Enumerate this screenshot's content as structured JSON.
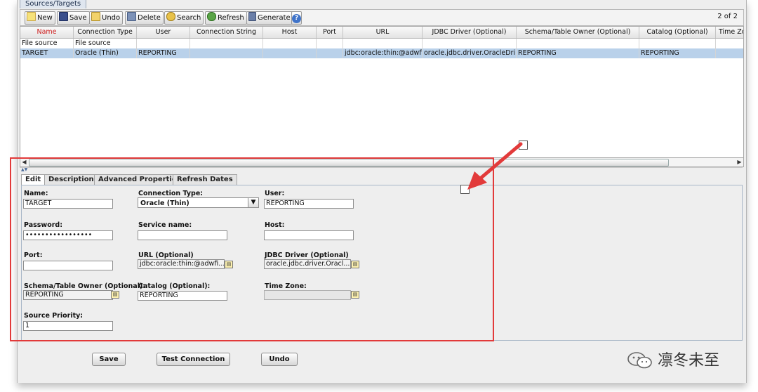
{
  "main_tab": "Sources/Targets",
  "toolbar": {
    "new": "New",
    "save": "Save",
    "undo": "Undo",
    "delete": "Delete",
    "search": "Search",
    "refresh": "Refresh",
    "generate": "Generate",
    "help": "?",
    "pager": "2 of 2"
  },
  "grid": {
    "headers": [
      "Name",
      "Connection Type",
      "User",
      "Connection String",
      "Host",
      "Port",
      "URL",
      "JDBC Driver (Optional)",
      "Schema/Table Owner (Optional)",
      "Catalog (Optional)",
      "Time Zo"
    ],
    "rows": [
      [
        "File source",
        "File source",
        "",
        "",
        "",
        "",
        "",
        "",
        "",
        "",
        ""
      ],
      [
        "TARGET",
        "Oracle (Thin)",
        "REPORTING",
        "",
        "",
        "",
        "jdbc:oracle:thin:@adwfi...",
        "oracle.jdbc.driver.OracleDri...",
        "REPORTING",
        "REPORTING",
        ""
      ]
    ],
    "selected_row": 1
  },
  "subtabs": [
    "Edit",
    "Description",
    "Advanced Properties",
    "Refresh Dates"
  ],
  "form": {
    "name_label": "Name:",
    "name_value": "TARGET",
    "conntype_label": "Connection Type:",
    "conntype_value": "Oracle (Thin)",
    "user_label": "User:",
    "user_value": "REPORTING",
    "password_label": "Password:",
    "password_value": "•••••••••••••••••",
    "service_label": "Service name:",
    "service_value": "",
    "host_label": "Host:",
    "host_value": "",
    "port_label": "Port:",
    "port_value": "",
    "url_label": "URL (Optional)",
    "url_value": "jdbc:oracle:thin:@adwfi...",
    "jdbc_label": "JDBC Driver (Optional)",
    "jdbc_value": "oracle.jdbc.driver.Oracl...",
    "schema_label": "Schema/Table Owner (Optional):",
    "schema_value": "REPORTING",
    "catalog_label": "Catalog (Optional):",
    "catalog_value": "REPORTING",
    "timezone_label": "Time Zone:",
    "timezone_value": "",
    "priority_label": "Source Priority:",
    "priority_value": "1"
  },
  "buttons": {
    "save": "Save",
    "test": "Test Connection",
    "undo": "Undo"
  },
  "watermark": "凛冬未至",
  "colors": {
    "selection": "#b9d1ea",
    "annotation_red": "#e23a3a"
  }
}
